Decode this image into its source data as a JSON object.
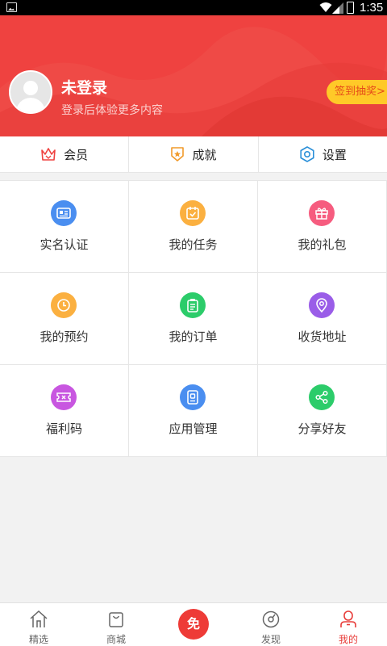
{
  "status_bar": {
    "time": "1:35"
  },
  "profile": {
    "username": "未登录",
    "subtitle": "登录后体验更多内容",
    "signin_label": "签到抽奖>"
  },
  "quick_row": [
    {
      "label": "会员",
      "icon": "crown-icon"
    },
    {
      "label": "成就",
      "icon": "medal-icon"
    },
    {
      "label": "设置",
      "icon": "gear-icon"
    }
  ],
  "grid": [
    {
      "label": "实名认证",
      "icon": "id-card-icon",
      "color": "#4a8ef0"
    },
    {
      "label": "我的任务",
      "icon": "task-calendar-icon",
      "color": "#fbb040"
    },
    {
      "label": "我的礼包",
      "icon": "gift-icon",
      "color": "#f65c7f"
    },
    {
      "label": "我的预约",
      "icon": "clock-icon",
      "color": "#fbb040"
    },
    {
      "label": "我的订单",
      "icon": "clipboard-icon",
      "color": "#2ccc6a"
    },
    {
      "label": "收货地址",
      "icon": "location-pin-icon",
      "color": "#9a5de8"
    },
    {
      "label": "福利码",
      "icon": "ticket-icon",
      "color": "#c856e0"
    },
    {
      "label": "应用管理",
      "icon": "app-manage-icon",
      "color": "#4a8ef0"
    },
    {
      "label": "分享好友",
      "icon": "share-icon",
      "color": "#2ccc6a"
    }
  ],
  "tabs": [
    {
      "label": "精选",
      "icon": "home-icon",
      "active": false
    },
    {
      "label": "商城",
      "icon": "shopping-bag-icon",
      "active": false
    },
    {
      "label": "免",
      "icon": "free-button",
      "active": false
    },
    {
      "label": "发现",
      "icon": "compass-icon",
      "active": false
    },
    {
      "label": "我的",
      "icon": "person-icon",
      "active": true
    }
  ],
  "colors": {
    "brand_red": "#ef4240",
    "active_tab": "#e83d3a",
    "signin_bg": "#ffc928"
  }
}
